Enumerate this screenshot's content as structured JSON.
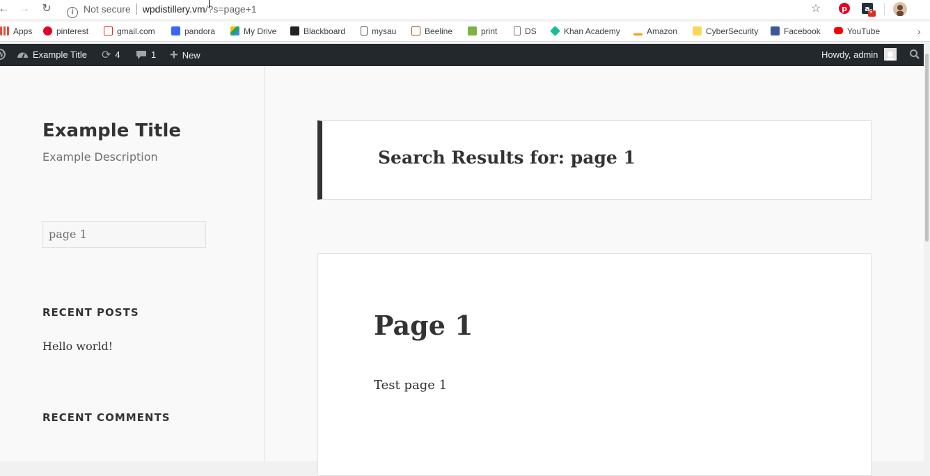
{
  "browser": {
    "url_prefix": "Not secure",
    "url_host": "wpdistillery.vm",
    "url_path": "/?s=page+1",
    "extension_badge": "9"
  },
  "bookmarks": [
    {
      "label": "Apps",
      "icon": "apps-grid-icon",
      "color": "#e74c3c"
    },
    {
      "label": "pinterest",
      "icon": "pinterest-icon",
      "color": "#e60023"
    },
    {
      "label": "gmail.com",
      "icon": "gmail-icon",
      "color": "#d93025"
    },
    {
      "label": "pandora",
      "icon": "pandora-icon",
      "color": "#3668ff"
    },
    {
      "label": "My Drive",
      "icon": "google-drive-icon",
      "color": "#1fa463"
    },
    {
      "label": "Blackboard",
      "icon": "blackboard-icon",
      "color": "#222222"
    },
    {
      "label": "mysau",
      "icon": "document-icon",
      "color": "#555555"
    },
    {
      "label": "Beeline",
      "icon": "beeline-icon",
      "color": "#8b5a2b"
    },
    {
      "label": "print",
      "icon": "print-icon",
      "color": "#7cb342"
    },
    {
      "label": "DS",
      "icon": "page-icon",
      "color": "#777777"
    },
    {
      "label": "Khan Academy",
      "icon": "khan-academy-icon",
      "color": "#14bf96"
    },
    {
      "label": "Amazon",
      "icon": "amazon-icon",
      "color": "#ff9900"
    },
    {
      "label": "CyberSecurity",
      "icon": "folder-icon",
      "color": "#fbd75b"
    },
    {
      "label": "Facebook",
      "icon": "facebook-icon",
      "color": "#3b5998"
    },
    {
      "label": "YouTube",
      "icon": "youtube-icon",
      "color": "#ff0000"
    }
  ],
  "adminbar": {
    "site_name": "Example Title",
    "updates_count": "4",
    "comments_count": "1",
    "new_label": "New",
    "howdy": "Howdy, admin"
  },
  "sidebar": {
    "site_title": "Example Title",
    "site_description": "Example Description",
    "search_value": "page 1",
    "recent_posts_title": "RECENT POSTS",
    "recent_posts": [
      "Hello world!"
    ],
    "recent_comments_title": "RECENT COMMENTS"
  },
  "main": {
    "results_title": "Search Results for: page 1",
    "post_title": "Page 1",
    "post_excerpt": "Test page 1"
  }
}
